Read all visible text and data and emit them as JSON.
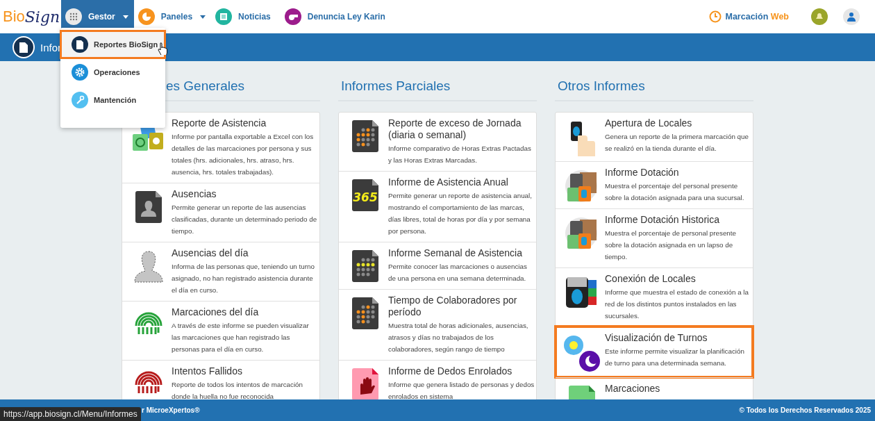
{
  "logo": {
    "part_1": "Bio",
    "part_2": "Sign"
  },
  "nav": [
    {
      "label": "Gestor",
      "selected": true,
      "has_caret": true
    },
    {
      "label": "Paneles",
      "selected": false,
      "has_caret": true
    },
    {
      "label": "Noticias",
      "selected": false,
      "has_caret": false
    },
    {
      "label": "Denuncia Ley Karin",
      "selected": false,
      "has_caret": false
    }
  ],
  "marcacion": {
    "part_1": "Marcación",
    "part_2": "Web"
  },
  "page_title": "Infor",
  "dropdown": [
    {
      "label": "Reportes BioSign",
      "highlighted": true
    },
    {
      "label": "Operaciones",
      "highlighted": false
    },
    {
      "label": "Mantención",
      "highlighted": false
    }
  ],
  "columns": [
    {
      "heading": "es Generales",
      "reports": [
        {
          "title": "Reporte de Asistencia",
          "description": "Informe por pantalla exportable a Excel con los detalles de las marcaciones por persona y sus totales (hrs. adicionales, hrs. atraso, hrs. ausencia, hrs. totales trabajadas).",
          "highlighted": false
        },
        {
          "title": "Ausencias",
          "description": "Permite generar un reporte de las ausencias clasificadas, durante un determinado periodo de tiempo.",
          "highlighted": false
        },
        {
          "title": "Ausencias del día",
          "description": "Informa de las personas que, teniendo un turno asignado, no han registrado asistencia durante el día en curso.",
          "highlighted": false
        },
        {
          "title": "Marcaciones del día",
          "description": "A través de este informe se pueden visualizar las marcaciones que han registrado las personas para el día en curso.",
          "highlighted": false
        },
        {
          "title": "Intentos Fallidos",
          "description": "Reporte de todos los intentos de marcación donde la huella no fue reconocida",
          "highlighted": false
        }
      ]
    },
    {
      "heading": "Informes Parciales",
      "reports": [
        {
          "title": "Reporte de exceso de Jornada (diaria o semanal)",
          "description": "Informe comparativo de Horas Extras Pactadas y las Horas Extras Marcadas.",
          "highlighted": false
        },
        {
          "title": "Informe de Asistencia Anual",
          "description": "Permite generar un reporte de asistencia anual, mostrando el comportamiento de las marcas, días libres, total de horas por día y por semana por persona.",
          "highlighted": false,
          "icon_text": "365"
        },
        {
          "title": "Informe Semanal de Asistencia",
          "description": "Permite conocer las marcaciones o ausencias de una persona en una semana determinada.",
          "highlighted": false
        },
        {
          "title": "Tiempo de Colaboradores por período",
          "description": "Muestra total de horas adicionales, ausencias, atrasos y días no trabajados de los colaboradores, según rango de tiempo",
          "highlighted": false
        },
        {
          "title": "Informe de Dedos Enrolados",
          "description": "Informe que genera listado de personas y dedos enrolados en sistema",
          "highlighted": false
        }
      ]
    },
    {
      "heading": "Otros Informes",
      "reports": [
        {
          "title": "Apertura de Locales",
          "description": "Genera un reporte de la primera marcación que se realizó en la tienda durante el día.",
          "highlighted": false
        },
        {
          "title": "Informe Dotación",
          "description": "Muestra el porcentaje del personal presente sobre la dotación asignada para una sucursal.",
          "highlighted": false
        },
        {
          "title": "Informe Dotación Historica",
          "description": "Muestra el porcentaje de personal presente sobre la dotación asignada en un lapso de tiempo.",
          "highlighted": false
        },
        {
          "title": "Conexión de Locales",
          "description": "Informe que muestra el estado de conexión a la red de los distintos puntos instalados en las sucursales.",
          "highlighted": false
        },
        {
          "title": "Visualización de Turnos",
          "description": "Este informe permite visualizar la planificación de turno para una determinada semana.",
          "highlighted": true
        },
        {
          "title": "Marcaciones",
          "highlighted": false
        }
      ]
    }
  ],
  "footer": {
    "left": "r MicroeXpertos®",
    "right": "© Todos los Derechos Reservados 2025"
  },
  "status_url": "https://app.biosign.cl/Menu/Informes"
}
